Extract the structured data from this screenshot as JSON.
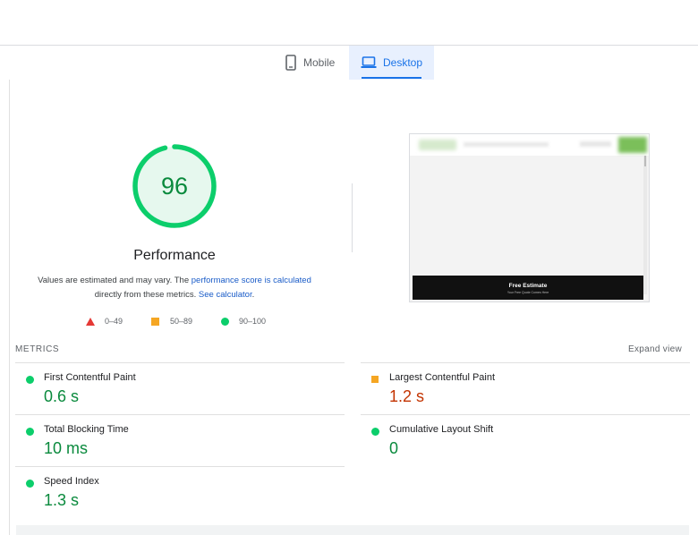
{
  "tabs": {
    "mobile_label": "Mobile",
    "desktop_label": "Desktop",
    "selected": "Desktop"
  },
  "score": {
    "value": "96",
    "fraction": 0.96,
    "title": "Performance",
    "description_pre": "Values are estimated and may vary. The ",
    "description_link1": "performance score is calculated",
    "description_mid": " directly from these metrics. ",
    "description_link2": "See calculator",
    "description_end": "."
  },
  "legend": {
    "fail": "0–49",
    "average": "50–89",
    "pass": "90–100"
  },
  "screenshot": {
    "footer_title": "Free Estimate",
    "footer_sub": "Your Free Quote Comes Here"
  },
  "metrics": {
    "section_label": "METRICS",
    "expand_label": "Expand view",
    "fcp": {
      "name": "First Contentful Paint",
      "value": "0.6 s",
      "status": "pass"
    },
    "lcp": {
      "name": "Largest Contentful Paint",
      "value": "1.2 s",
      "status": "average"
    },
    "tbt": {
      "name": "Total Blocking Time",
      "value": "10 ms",
      "status": "pass"
    },
    "cls": {
      "name": "Cumulative Layout Shift",
      "value": "0",
      "status": "pass"
    },
    "si": {
      "name": "Speed Index",
      "value": "1.3 s",
      "status": "pass"
    }
  },
  "colors": {
    "pass": "#0cce6b",
    "pass_text": "#0a8a3d",
    "average": "#f5a623",
    "average_text": "#c33300",
    "fail": "#e53935",
    "accent": "#1a73e8"
  }
}
